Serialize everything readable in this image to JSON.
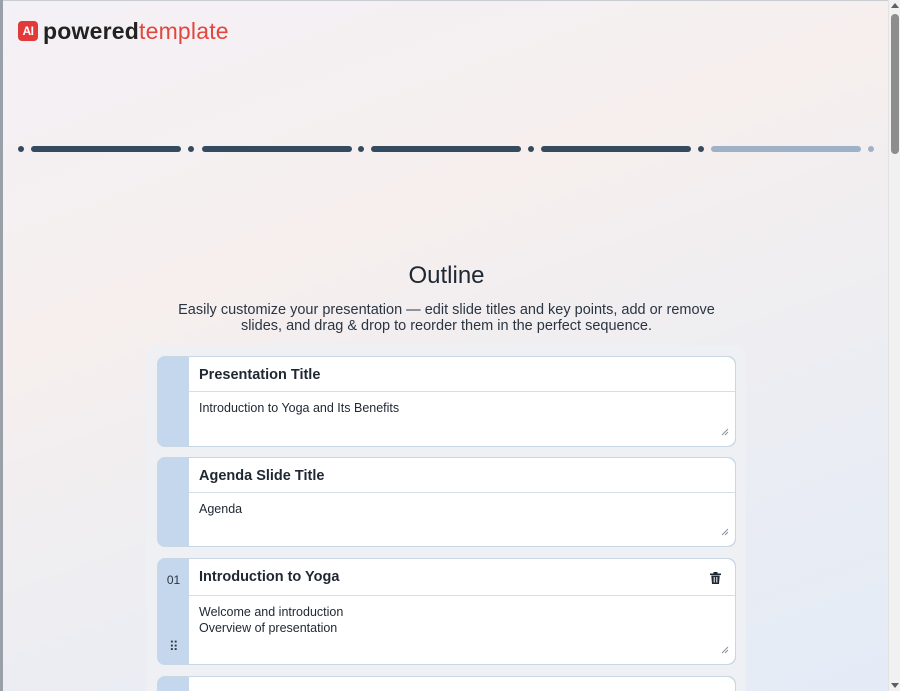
{
  "brand": {
    "mark": "AI",
    "name_bold": "powered",
    "name_light": "template",
    "accent_color": "#e2473f"
  },
  "progress": {
    "total_steps": 5,
    "completed_steps": 4,
    "active_color": "#344a5e",
    "inactive_color": "#9eb1c6"
  },
  "page": {
    "title": "Outline",
    "subtitle": "Easily customize your presentation — edit slide titles and key points, add or remove slides, and drag & drop to reorder them in the perfect sequence."
  },
  "cards": [
    {
      "number": "",
      "title": "Presentation Title",
      "content": "Introduction to Yoga and Its Benefits",
      "deletable": false,
      "draggable": false
    },
    {
      "number": "",
      "title": "Agenda Slide Title",
      "content": "Agenda",
      "deletable": false,
      "draggable": false
    },
    {
      "number": "01",
      "title": "Introduction to Yoga",
      "content": "Welcome and introduction\nOverview of presentation",
      "deletable": true,
      "draggable": true,
      "delete_icon": "trash-icon",
      "drag_icon": "drag-handle-icon"
    },
    {
      "number": "",
      "title": "",
      "content": ""
    }
  ]
}
